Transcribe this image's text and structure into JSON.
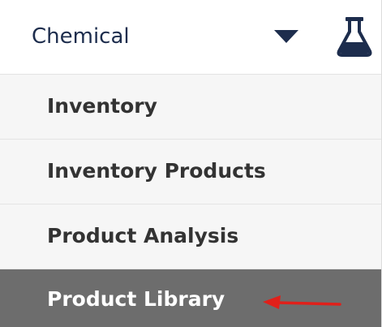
{
  "header": {
    "title": "Chemical",
    "dropdown_icon": "caret-down-icon",
    "app_icon": "flask-icon",
    "accent_color": "#1d2d4d"
  },
  "menu": {
    "items": [
      {
        "label": "Inventory",
        "active": false
      },
      {
        "label": "Inventory Products",
        "active": false
      },
      {
        "label": "Product Analysis",
        "active": false
      },
      {
        "label": "Product Library",
        "active": true
      }
    ],
    "active_background": "#6d6d6d"
  },
  "annotation": {
    "arrow_icon": "red-arrow-icon",
    "arrow_color": "#e0201a"
  }
}
